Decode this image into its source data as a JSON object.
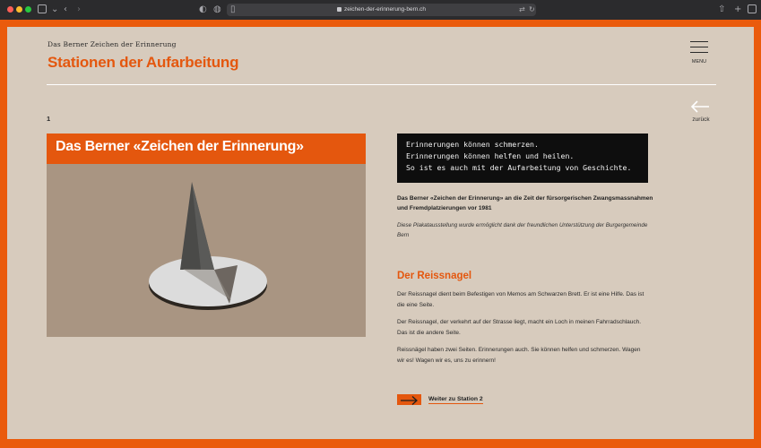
{
  "browser": {
    "url": "zeichen-der-erinnerung-bern.ch"
  },
  "site": {
    "kicker": "Das Berner Zeichen der Erinnerung",
    "title": "Stationen der Aufarbeitung",
    "menu_label": "MENU",
    "back_label": "zurück"
  },
  "station": {
    "number": "1",
    "hero_title": "Das Berner «Zeichen der Erinnerung»",
    "quote_lines": [
      "Erinnerungen können schmerzen.",
      "Erinnerungen können helfen und heilen.",
      "So ist es auch mit der Aufarbeitung von Geschichte."
    ],
    "intro_bold": "Das Berner «Zeichen der Erinnerung» an die Zeit der fürsorgerischen Zwangsmassnahmen und Fremdplatzierungen vor 1981",
    "intro_italic": "Diese Plakatausstellung wurde ermöglicht dank der freundlichen Unterstützung der Burgergemeinde Bern",
    "section_title": "Der Reissnagel",
    "paragraphs": [
      "Der Reissnagel dient beim Befestigen von Memos am Schwarzen Brett. Er ist eine Hilfe. Das ist die eine Seite.",
      "Der Reissnagel, der verkehrt auf der Strasse liegt, macht ein Loch in meinen Fahrradschlauch. Das ist die andere Seite.",
      "Reissnägel haben zwei Seiten. Erinnerungen auch. Sie können helfen und schmerzen. Wagen wir es! Wagen wir es, uns zu erinnern!"
    ],
    "next_label": "Weiter zu Station 2"
  },
  "colors": {
    "accent": "#e4570e",
    "frame": "#ea5b0c",
    "page_bg": "#d7cbbd",
    "quote_bg": "#0e0e0e"
  }
}
